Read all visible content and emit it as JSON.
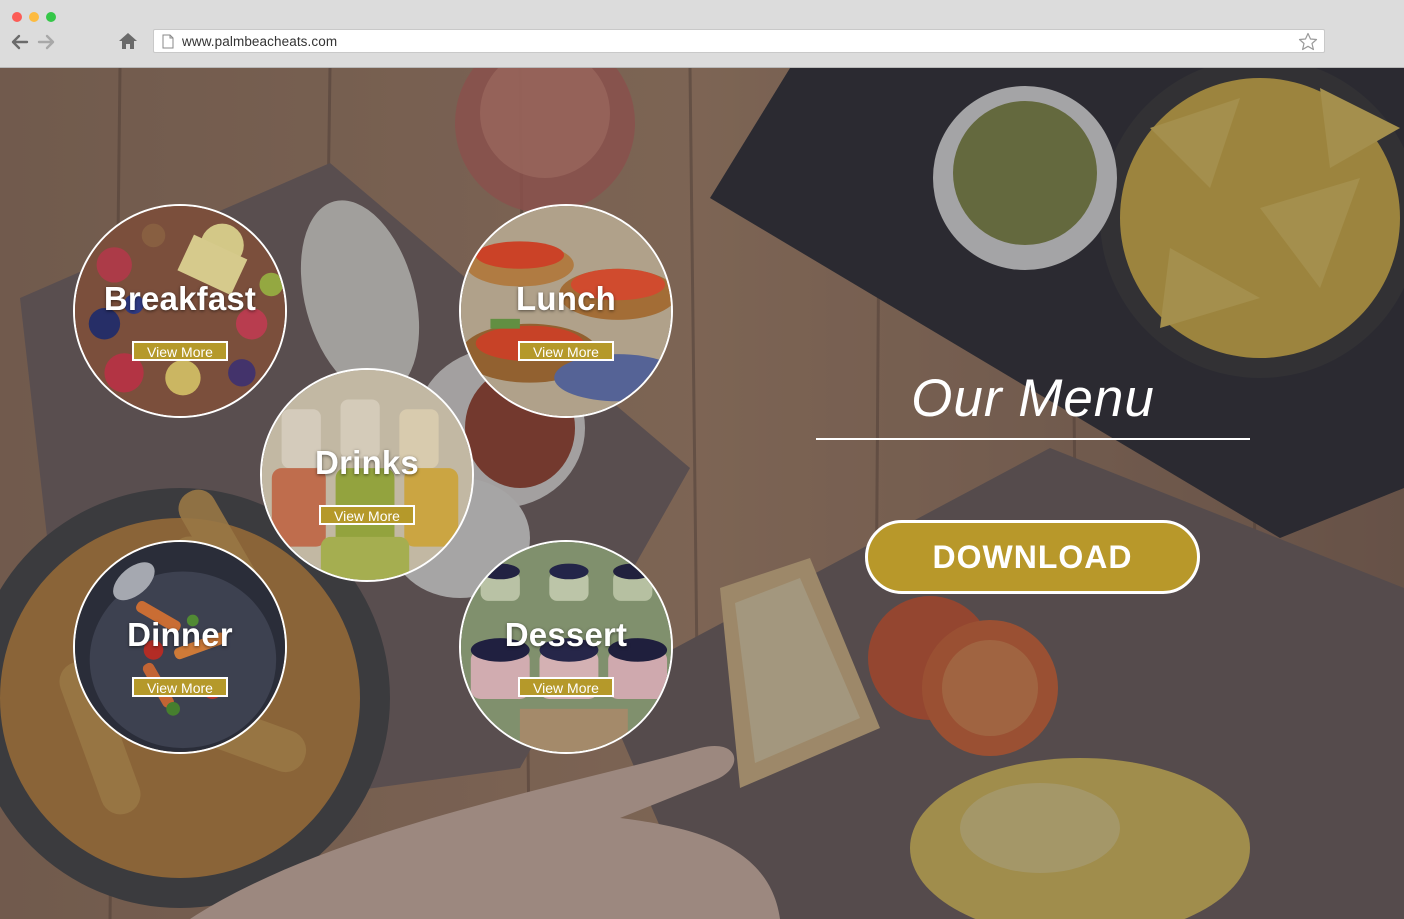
{
  "browser": {
    "url": "www.palmbeacheats.com",
    "back_icon": "arrow-left-icon",
    "forward_icon": "arrow-right-icon",
    "home_icon": "home-icon",
    "bookmark_icon": "star-icon"
  },
  "hero": {
    "title": "Our Menu",
    "download_label": "DOWNLOAD",
    "accent_color": "#b8982a"
  },
  "categories": [
    {
      "name": "Breakfast",
      "button": "View More"
    },
    {
      "name": "Lunch",
      "button": "View More"
    },
    {
      "name": "Drinks",
      "button": "View More"
    },
    {
      "name": "Dinner",
      "button": "View More"
    },
    {
      "name": "Dessert",
      "button": "View More"
    }
  ]
}
